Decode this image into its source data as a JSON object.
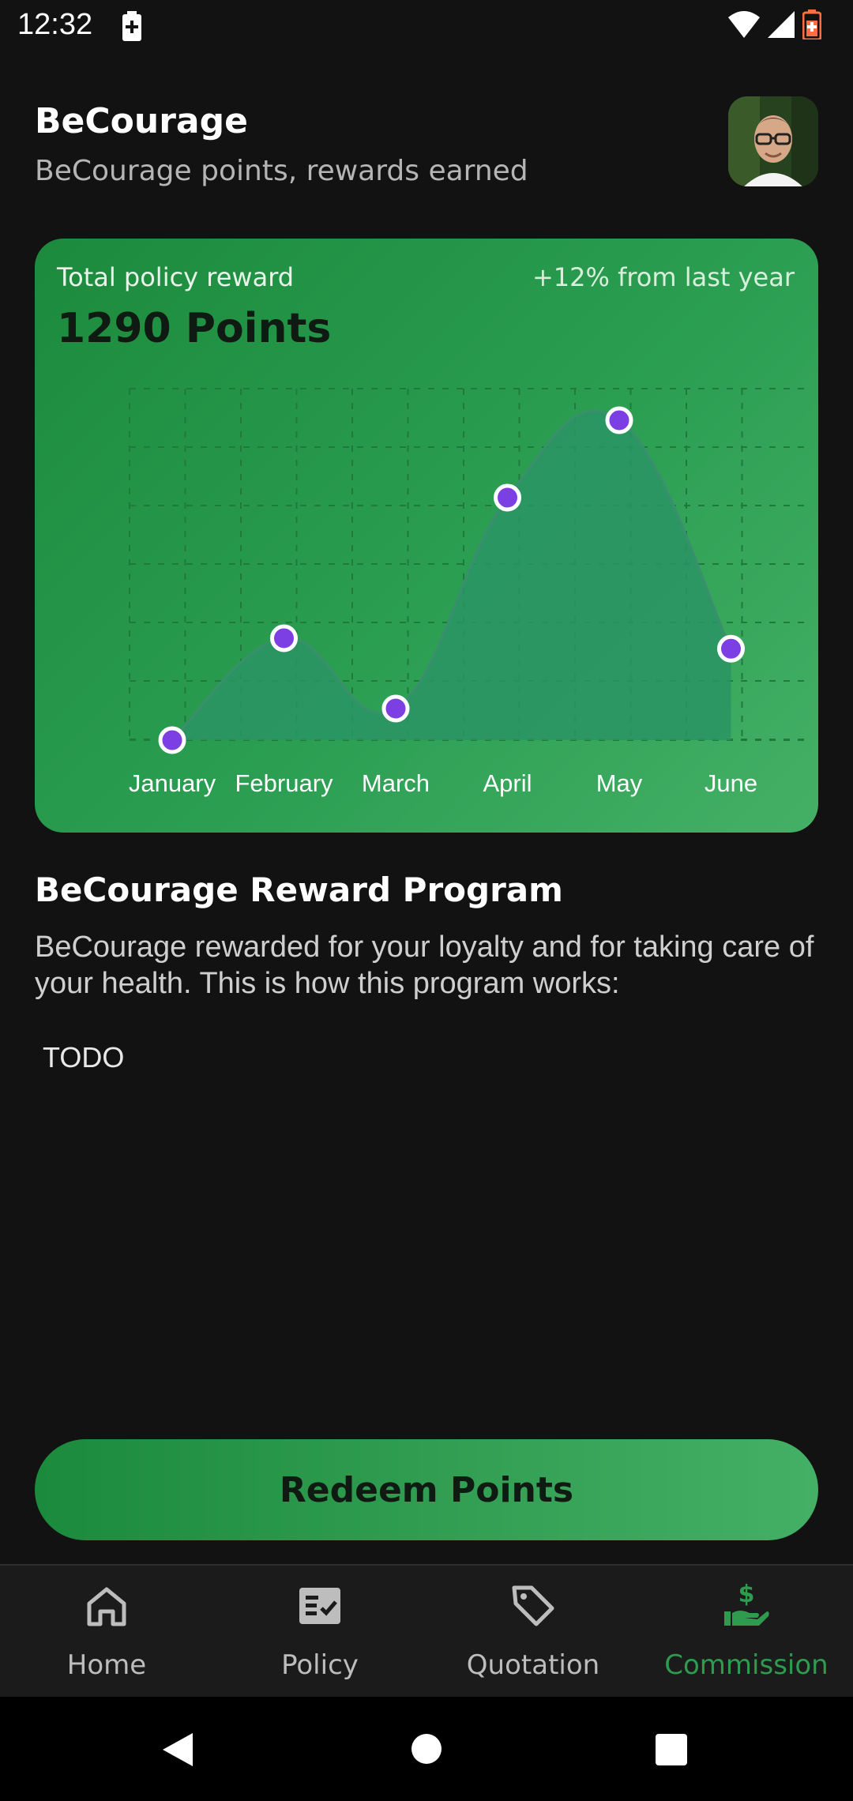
{
  "status_bar": {
    "time": "12:32"
  },
  "header": {
    "title": "BeCourage",
    "subtitle": "BeCourage points, rewards earned"
  },
  "reward_card": {
    "label": "Total policy reward",
    "change": "+12% from last year",
    "points": "1290 Points"
  },
  "chart_data": {
    "type": "area",
    "categories": [
      "January",
      "February",
      "March",
      "April",
      "May",
      "June"
    ],
    "values": [
      0,
      29,
      9,
      69,
      91,
      26
    ],
    "ylim": [
      0,
      100
    ],
    "grid": true,
    "colors": {
      "line": "#3a8f6e",
      "fill": "#2a9464",
      "point_fill": "#7b3fe4",
      "point_stroke": "#ffffff"
    }
  },
  "program": {
    "title": "BeCourage Reward Program",
    "body": "BeCourage rewarded for your loyalty and for taking care of your health. This is how this program works:",
    "todo": "TODO"
  },
  "redeem_button": {
    "label": "Redeem Points"
  },
  "bottom_nav": {
    "items": [
      {
        "label": "Home",
        "icon": "home-icon",
        "active": false
      },
      {
        "label": "Policy",
        "icon": "policy-check-icon",
        "active": false
      },
      {
        "label": "Quotation",
        "icon": "tag-icon",
        "active": false
      },
      {
        "label": "Commission",
        "icon": "hand-dollar-icon",
        "active": true
      }
    ]
  },
  "colors": {
    "accent": "#2e9b4e",
    "background": "#121212"
  }
}
